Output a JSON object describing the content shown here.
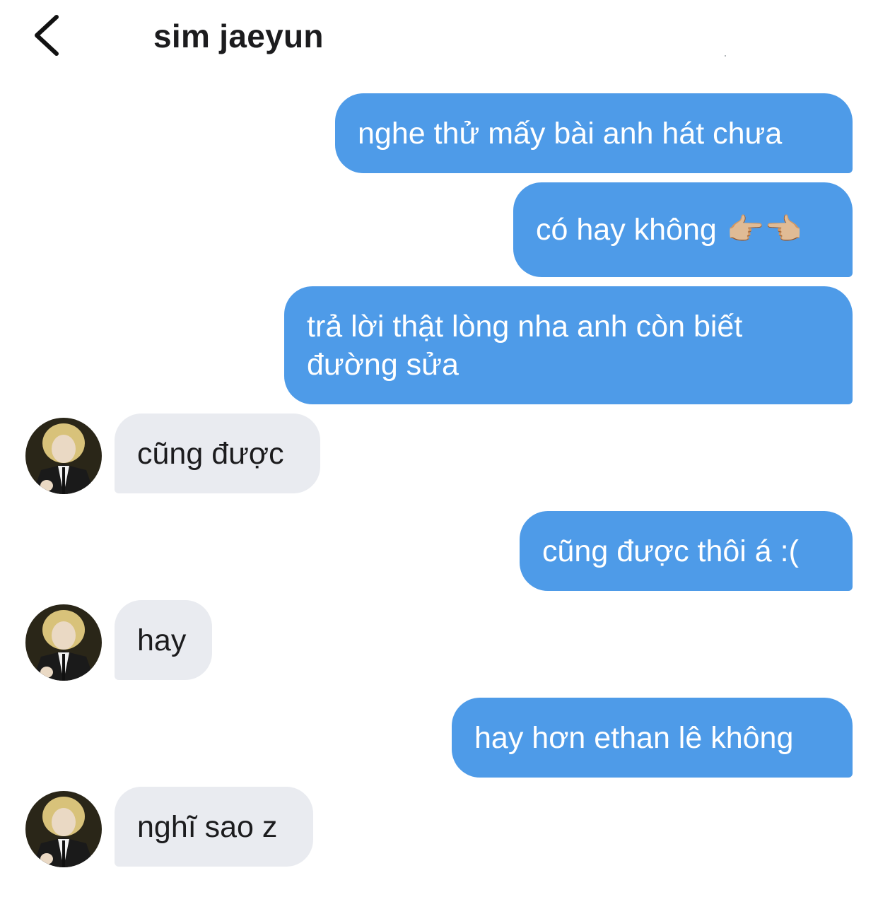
{
  "header": {
    "back_icon": "chevron-left-icon",
    "contact_name": "sim jaeyun"
  },
  "colors": {
    "outgoing_bubble": "#4e9be8",
    "incoming_bubble": "#e9ebf0",
    "outgoing_text": "#ffffff",
    "incoming_text": "#1c1c1e"
  },
  "messages": [
    {
      "direction": "outgoing",
      "text": "nghe thử mấy bài anh hát chưa"
    },
    {
      "direction": "outgoing",
      "text": "có hay không",
      "emoji": "👉🏼👈🏼"
    },
    {
      "direction": "outgoing",
      "text_line1": "trả lời thật lòng nha anh còn biết",
      "text_line2": "đường sửa"
    },
    {
      "direction": "incoming",
      "text": "cũng được"
    },
    {
      "direction": "outgoing",
      "text": "cũng được thôi á :("
    },
    {
      "direction": "incoming",
      "text": "hay"
    },
    {
      "direction": "outgoing",
      "text": "hay hơn ethan lê không"
    },
    {
      "direction": "incoming",
      "text": "nghĩ sao z"
    }
  ]
}
